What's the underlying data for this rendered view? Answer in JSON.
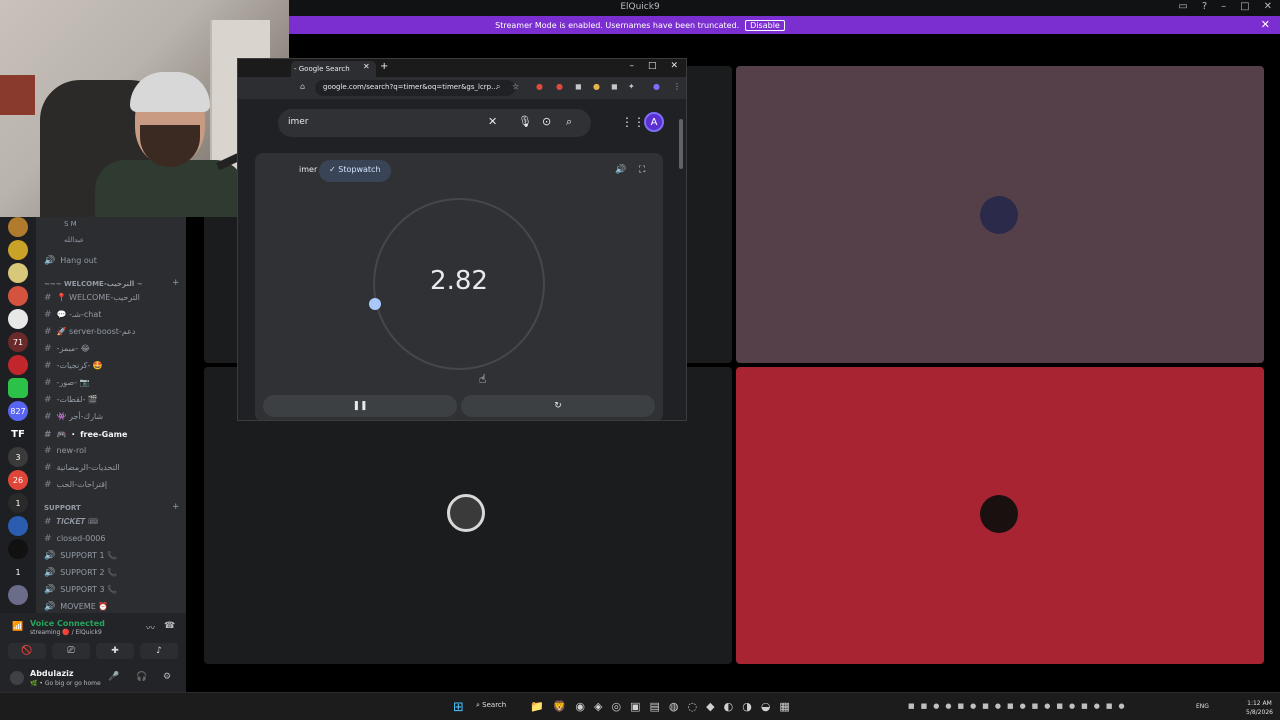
{
  "app": {
    "window_title": "ElQuick9"
  },
  "banner": {
    "text": "Streamer Mode is enabled. Usernames have been truncated.",
    "disable_label": "Disable"
  },
  "rail": {
    "badges": [
      "71",
      "827",
      "3",
      "26",
      "1",
      "1"
    ],
    "tf_label": "TF"
  },
  "channels": {
    "voice_users": [
      "S M",
      "عبدالله"
    ],
    "hang_out": "Hang out",
    "welcome_category": "~~~ WELCOME-الترحيب ~",
    "items": [
      {
        "name": "📍 WELCOME-الترحيب",
        "type": "text"
      },
      {
        "name": "💬 -شـ-chat",
        "type": "text"
      },
      {
        "name": "🚀 server-boost-دعم",
        "type": "text"
      },
      {
        "name": "-ميمز- 😂",
        "type": "text"
      },
      {
        "name": "-كرنجيات- 🤩",
        "type": "text"
      },
      {
        "name": "-صور- 📷",
        "type": "text"
      },
      {
        "name": "-لقطات- 🎬",
        "type": "text"
      },
      {
        "name": "👾 شارك-أجر",
        "type": "text"
      },
      {
        "name": "🎮 ・ free-Game",
        "type": "text",
        "active": true
      },
      {
        "name": "new-rol",
        "type": "text"
      },
      {
        "name": "التحديات-الرمضانية",
        "type": "text"
      },
      {
        "name": "إقتراحات-الحب",
        "type": "text"
      }
    ],
    "support_category": "SUPPORT",
    "support_items": [
      {
        "name": "𝑻𝑰𝑪𝑲𝑬𝑻 🎟",
        "type": "text"
      },
      {
        "name": "closed-0006",
        "type": "text"
      },
      {
        "name": "SUPPORT 1 📞",
        "type": "voice"
      },
      {
        "name": "SUPPORT 2 📞",
        "type": "voice"
      },
      {
        "name": "SUPPORT 3 📞",
        "type": "voice"
      },
      {
        "name": "MOVEME ⏰",
        "type": "voice"
      }
    ]
  },
  "voice": {
    "status": "Voice Connected",
    "sub": "streaming 🔴 / ElQuick9"
  },
  "user": {
    "name": "Abdulaziz",
    "status": "🌿 • Go big or go home"
  },
  "browser": {
    "tab_title": "- Google Search",
    "url": "google.com/search?q=timer&oq=timer&gs_lcrp...",
    "query": "imer",
    "account_initial": "A",
    "timer_tab": "imer",
    "stopwatch_label": "Stopwatch",
    "elapsed": "2.82"
  },
  "taskbar": {
    "search_label": "Search",
    "lang": "ENG",
    "time": "1:12 AM",
    "date": "5/8/2026"
  },
  "colors": {
    "banner": "#7b2fd1",
    "tile_mauve": "#554049",
    "tile_red": "#a82433",
    "tile_dark": "#1a1c1e",
    "voice_green": "#23a55a"
  }
}
